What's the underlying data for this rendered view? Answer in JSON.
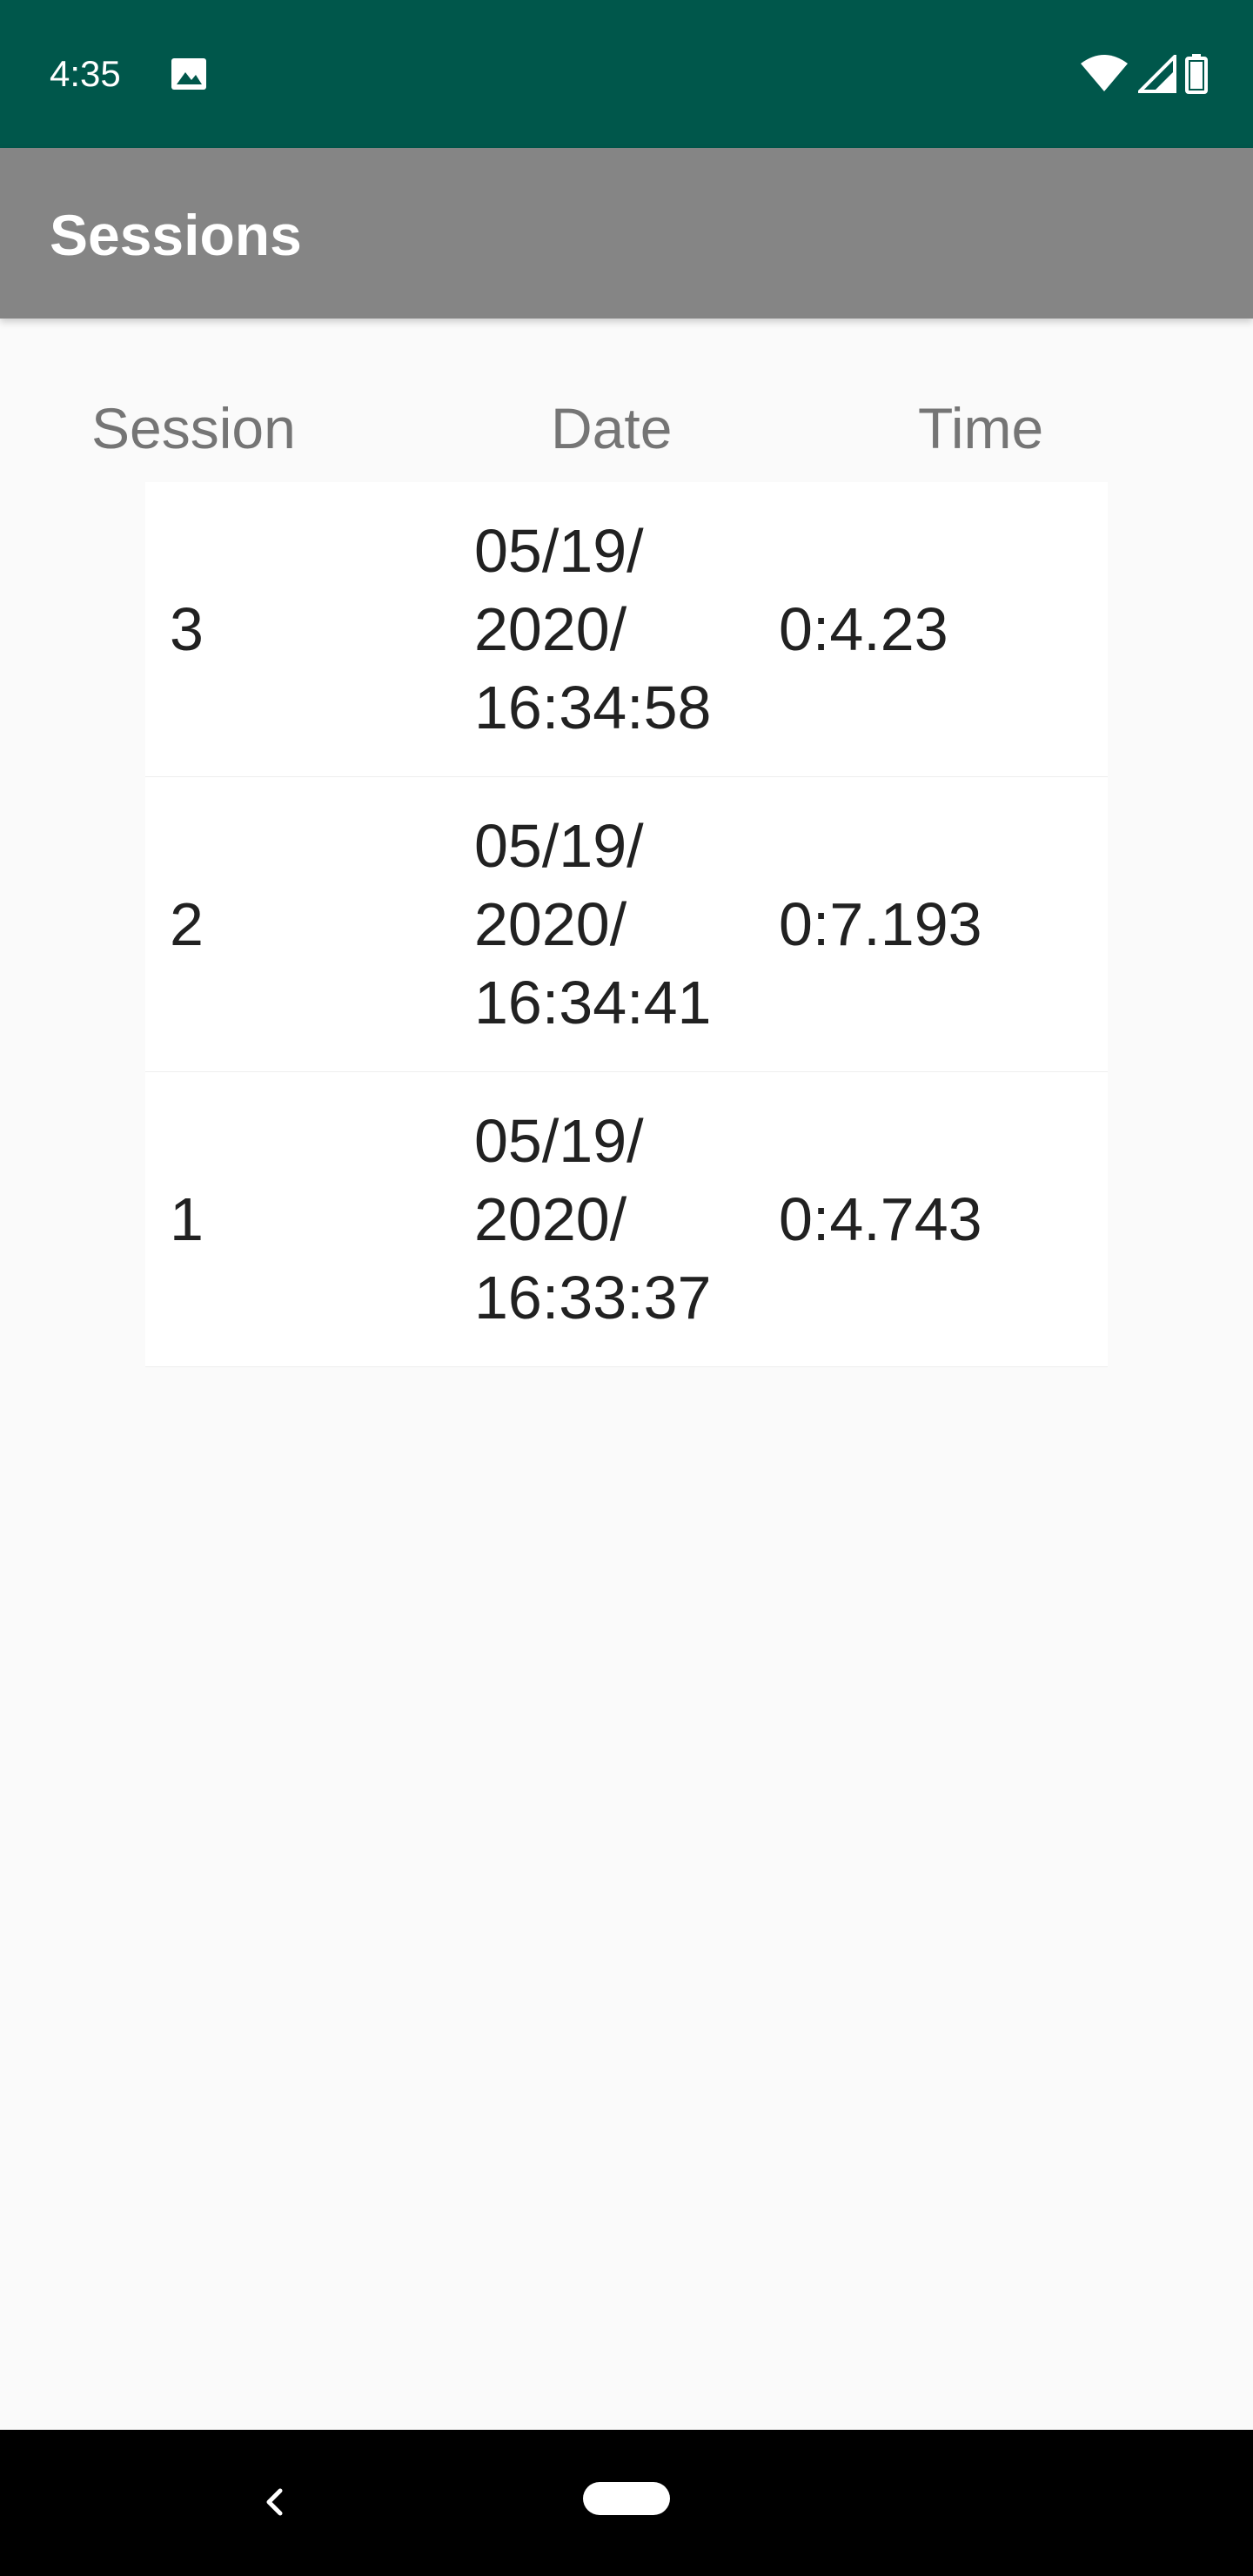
{
  "status_bar": {
    "time": "4:35",
    "icons": [
      "image-icon",
      "wifi-icon",
      "signal-icon",
      "battery-icon"
    ],
    "color": "#00574b"
  },
  "app_bar": {
    "title": "Sessions",
    "color": "#858585"
  },
  "table": {
    "headers": {
      "session": "Session",
      "date": "Date",
      "time": "Time"
    },
    "rows": [
      {
        "session": "3",
        "date": "05/19/\n2020/\n16:34:58",
        "time": "0:4.23"
      },
      {
        "session": "2",
        "date": "05/19/\n2020/\n16:34:41",
        "time": "0:7.193"
      },
      {
        "session": "1",
        "date": "05/19/\n2020/\n16:33:37",
        "time": "0:4.743"
      }
    ]
  },
  "nav_bar": {
    "icons": [
      "back-icon",
      "home-pill-icon"
    ]
  }
}
